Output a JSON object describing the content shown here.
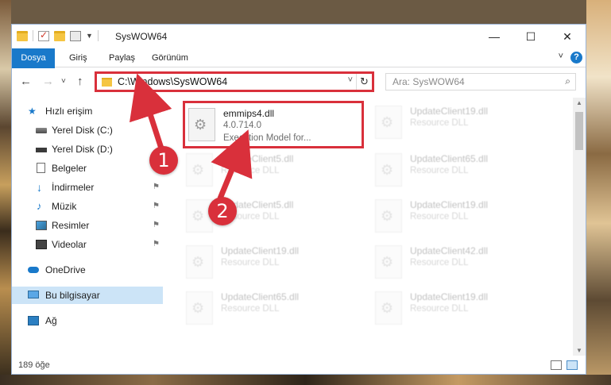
{
  "window": {
    "title": "SysWOW64",
    "controls": {
      "minimize": "—",
      "maximize": "☐",
      "close": "✕"
    }
  },
  "ribbon": {
    "tabs": [
      "Dosya",
      "Giriş",
      "Paylaş",
      "Görünüm"
    ],
    "help": "?",
    "expand": "˅"
  },
  "address": {
    "path": "C:\\Windows\\SysWOW64",
    "dropdown": "˅",
    "refresh": "↻",
    "back": "←",
    "forward": "→",
    "recent": "˅",
    "up": "↑"
  },
  "search": {
    "placeholder": "Ara: SysWOW64",
    "icon": "⌕"
  },
  "sidebar": {
    "items": [
      {
        "label": "Hızlı erişim",
        "icon": "star-icon"
      },
      {
        "label": "Yerel Disk (C:)",
        "icon": "drive-icon"
      },
      {
        "label": "Yerel Disk (D:)",
        "icon": "drive-icon"
      },
      {
        "label": "Belgeler",
        "icon": "documents-icon"
      },
      {
        "label": "İndirmeler",
        "icon": "downloads-icon",
        "pinned": true
      },
      {
        "label": "Müzik",
        "icon": "music-icon",
        "pinned": true
      },
      {
        "label": "Resimler",
        "icon": "pictures-icon",
        "pinned": true
      },
      {
        "label": "Videolar",
        "icon": "videos-icon",
        "pinned": true
      },
      {
        "label": "OneDrive",
        "icon": "onedrive-icon"
      },
      {
        "label": "Bu bilgisayar",
        "icon": "this-pc-icon",
        "selected": true
      },
      {
        "label": "Ağ",
        "icon": "network-icon"
      }
    ],
    "pin_glyph": "⚑",
    "star_glyph": "★",
    "down_glyph": "↓",
    "music_glyph": "♪"
  },
  "files": [
    {
      "name": "emmips4.dll",
      "line1": "4.0.714.0",
      "line2": "Execution Model for...",
      "highlight": true
    },
    {
      "name": "UpdateClient19.dll",
      "line1": "Resource DLL"
    },
    {
      "name": "UpdateClient5.dll",
      "line1": "Resource DLL"
    },
    {
      "name": "UpdateClient65.dll",
      "line1": "Resource DLL"
    },
    {
      "name": "UpdateClient5.dll",
      "line1": "Resource DLL"
    },
    {
      "name": "UpdateClient19.dll",
      "line1": "Resource DLL"
    },
    {
      "name": "UpdateClient19.dll",
      "line1": "Resource DLL"
    },
    {
      "name": "UpdateClient42.dll",
      "line1": "Resource DLL"
    },
    {
      "name": "UpdateClient65.dll",
      "line1": "Resource DLL"
    },
    {
      "name": "UpdateClient19.dll",
      "line1": "Resource DLL"
    }
  ],
  "status": {
    "count": "189 öğe"
  },
  "annotations": {
    "step1": "1",
    "step2": "2"
  },
  "colors": {
    "accent": "#1979ca",
    "highlight": "#d9303b",
    "selected": "#cce4f7"
  }
}
